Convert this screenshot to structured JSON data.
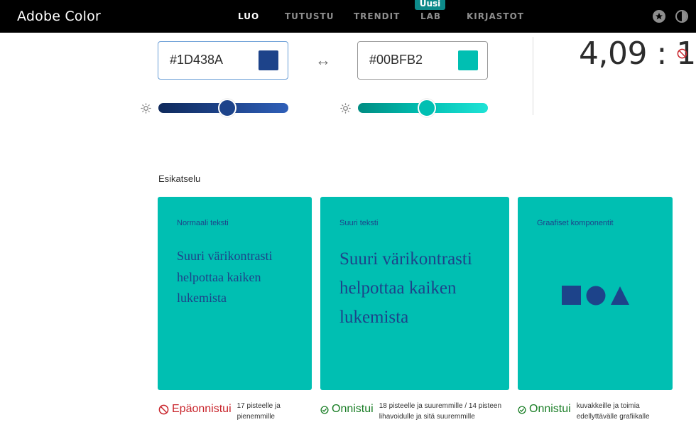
{
  "app": {
    "title": "Adobe Color"
  },
  "nav": {
    "items": [
      {
        "label": "LUO",
        "active": true
      },
      {
        "label": "TUTUSTU",
        "active": false
      },
      {
        "label": "TRENDIT",
        "active": false
      },
      {
        "label": "LAB",
        "active": false
      },
      {
        "label": "KIRJASTOT",
        "active": false
      }
    ],
    "new_badge": "Uusi",
    "icons": [
      "star-icon",
      "theme-toggle-icon"
    ]
  },
  "foreground": {
    "hex": "#1D438A",
    "color": "#1D438A",
    "brightness": 0.53
  },
  "background": {
    "hex": "#00BFB2",
    "color": "#00BFB2",
    "brightness": 0.53
  },
  "contrast": {
    "ratio_text": "4,09 : 1",
    "status_icon": "fail-icon"
  },
  "preview": {
    "title": "Esikatselu",
    "cards": [
      {
        "label": "Normaali teksti",
        "text": "Suuri värikontrasti helpottaa kaiken lukemista"
      },
      {
        "label": "Suuri teksti",
        "text": "Suuri värikontrasti helpottaa kaiken lukemista"
      },
      {
        "label": "Graafiset komponentit",
        "shapes": [
          "square",
          "circle",
          "triangle"
        ]
      }
    ],
    "results": [
      {
        "status": "Epäonnistui",
        "state": "fail",
        "description": "17 pisteelle ja pienemmille"
      },
      {
        "status": "Onnistui",
        "state": "pass",
        "description": "18 pisteelle ja suuremmille / 14 pisteen lihavoidulle ja sitä suuremmille"
      },
      {
        "status": "Onnistui",
        "state": "pass",
        "description": "kuvakkeille ja toimia edellyttävälle grafiikalle"
      }
    ]
  },
  "colors": {
    "fail": "#C9252C",
    "pass": "#1A7E26",
    "badge": "#0D8A8A"
  }
}
